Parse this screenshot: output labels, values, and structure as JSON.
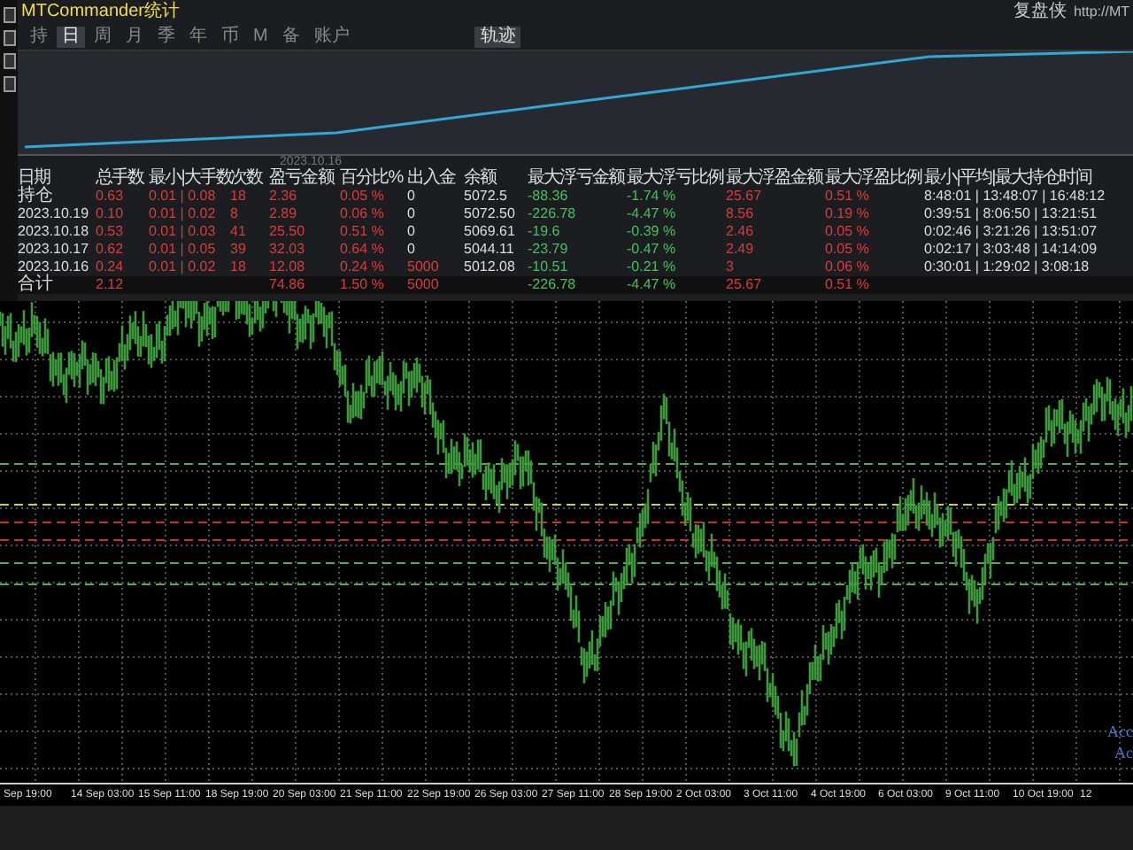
{
  "window": {
    "title": "MTCommander统计"
  },
  "header_right": {
    "brand": "复盘侠",
    "url": "http://MT"
  },
  "tabs": [
    {
      "label": "持",
      "selected": false
    },
    {
      "label": "日",
      "selected": true
    },
    {
      "label": "周",
      "selected": false
    },
    {
      "label": "月",
      "selected": false
    },
    {
      "label": "季",
      "selected": false
    },
    {
      "label": "年",
      "selected": false
    },
    {
      "label": "币",
      "selected": false
    },
    {
      "label": "M",
      "selected": false
    },
    {
      "label": "备",
      "selected": false
    },
    {
      "label": "账户",
      "selected": false
    }
  ],
  "track_button": {
    "label": "轨迹"
  },
  "equity_chart": {
    "date_label": "2023.10.16"
  },
  "table": {
    "columns": [
      "日期",
      "总手数",
      "最小|大手数",
      "次数",
      "盈亏金额",
      "百分比%",
      "出入金",
      "余额",
      "最大浮亏金额",
      "最大浮亏比例",
      "最大浮盈金额",
      "最大浮盈比例",
      "最小|平均|最大持仓时间"
    ],
    "rows": [
      {
        "deposit": false,
        "cells": [
          "持仓",
          "0.63",
          "0.01 | 0.08",
          "18",
          "2.36",
          "0.05 %",
          "0",
          "5072.5",
          "-88.36",
          "-1.74 %",
          "25.67",
          "0.51 %",
          "8:48:01 | 13:48:07 | 16:48:12"
        ]
      },
      {
        "deposit": false,
        "cells": [
          "2023.10.19",
          "0.10",
          "0.01 | 0.02",
          "8",
          "2.89",
          "0.06 %",
          "0",
          "5072.50",
          "-226.78",
          "-4.47 %",
          "8.56",
          "0.19 %",
          "0:39:51 | 8:06:50 | 13:21:51"
        ]
      },
      {
        "deposit": false,
        "cells": [
          "2023.10.18",
          "0.53",
          "0.01 | 0.03",
          "41",
          "25.50",
          "0.51 %",
          "0",
          "5069.61",
          "-19.6",
          "-0.39 %",
          "2.46",
          "0.05 %",
          "0:02:46 | 3:21:26 | 13:51:07"
        ]
      },
      {
        "deposit": false,
        "cells": [
          "2023.10.17",
          "0.62",
          "0.01 | 0.05",
          "39",
          "32.03",
          "0.64 %",
          "0",
          "5044.11",
          "-23.79",
          "-0.47 %",
          "2.49",
          "0.05 %",
          "0:02:17 | 3:03:48 | 14:14:09"
        ]
      },
      {
        "deposit": true,
        "cells": [
          "2023.10.16",
          "0.24",
          "0.01 | 0.02",
          "18",
          "12.08",
          "0.24 %",
          "5000",
          "5012.08",
          "-10.51",
          "-0.21 %",
          "3",
          "0.06 %",
          "0:30:01 | 1:29:02 | 3:08:18"
        ]
      }
    ],
    "total": {
      "deposit": true,
      "cells": [
        "合计",
        "2.12",
        null,
        null,
        "74.86",
        "1.50 %",
        "5000",
        null,
        "-226.78",
        "-4.47 %",
        "25.67",
        "0.51 %",
        null
      ]
    }
  },
  "price_chart": {
    "legend": [
      "Acc",
      "Ac"
    ],
    "time_axis": [
      "Sep 19:00",
      "14 Sep 03:00",
      "15 Sep 11:00",
      "18 Sep 19:00",
      "20 Sep 03:00",
      "21 Sep 11:00",
      "22 Sep 19:00",
      "26 Sep 03:00",
      "27 Sep 11:00",
      "28 Sep 19:00",
      "2 Oct 03:00",
      "3 Oct 11:00",
      "4 Oct 19:00",
      "6 Oct 03:00",
      "9 Oct 11:00",
      "10 Oct 19:00",
      "12"
    ]
  }
}
